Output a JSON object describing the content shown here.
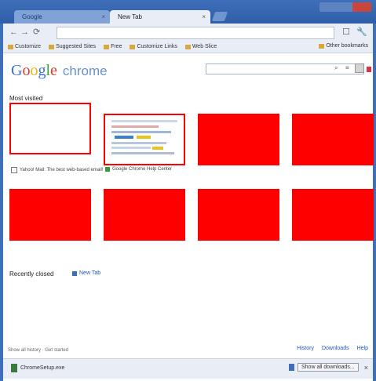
{
  "window": {
    "tabs": [
      {
        "label": "Google"
      },
      {
        "label": "New Tab"
      }
    ],
    "controls": [
      "minimize-icon",
      "maximize-icon",
      "close-icon"
    ]
  },
  "toolbar": {
    "back_icon": "←",
    "forward_icon": "→",
    "reload_icon": "⟳",
    "page_icon": "☐",
    "tools_icon": "🔧"
  },
  "bookmarks": {
    "items": [
      "Customize",
      "Suggested Sites",
      "Free",
      "Customize Links",
      "Web Slice"
    ],
    "other": "Other bookmarks"
  },
  "content": {
    "logo_google": "Google",
    "logo_chrome": "chrome",
    "most_visited_title": "Most visited",
    "thumbnails": [
      {
        "label": "Yahoo! Mail: The best web-based email!",
        "favicon_color": "#7b3fb1"
      },
      {
        "label": "Google Chrome Help Center",
        "favicon_color": "#3a9a3a"
      }
    ],
    "recently_closed_title": "Recently closed",
    "recently_closed_link": "New Tab",
    "footer_left": "Show all history · Get started",
    "footer_links": [
      "History",
      "Downloads",
      "Help"
    ]
  },
  "shelf": {
    "file_label": "ChromeSetup.exe",
    "show_all": "Show all downloads...",
    "close_icon": "×"
  },
  "colors": {
    "accent": "#3f6fb8",
    "thumbnail_red": "#fe0000",
    "link_blue": "#1f56b8"
  }
}
